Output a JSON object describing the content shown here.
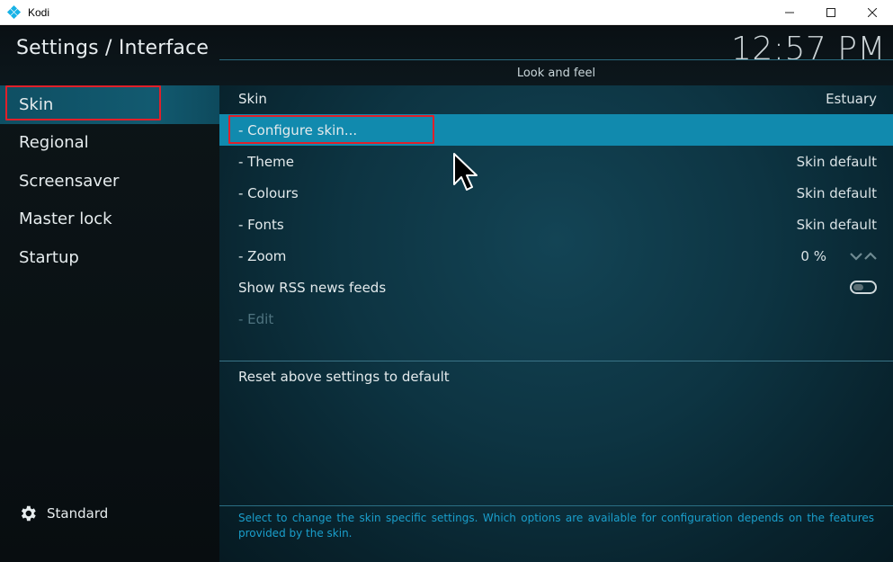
{
  "window": {
    "title": "Kodi"
  },
  "header": {
    "title": "Settings / Interface",
    "clock": "12:57 PM"
  },
  "sidebar": {
    "items": [
      {
        "label": "Skin",
        "active": true
      },
      {
        "label": "Regional",
        "active": false
      },
      {
        "label": "Screensaver",
        "active": false
      },
      {
        "label": "Master lock",
        "active": false
      },
      {
        "label": "Startup",
        "active": false
      }
    ],
    "footer_label": "Standard"
  },
  "main": {
    "group_title": "Look and feel",
    "settings": [
      {
        "label": "Skin",
        "value": "Estuary"
      },
      {
        "label": "- Configure skin...",
        "value": ""
      },
      {
        "label": "- Theme",
        "value": "Skin default"
      },
      {
        "label": "- Colours",
        "value": "Skin default"
      },
      {
        "label": "- Fonts",
        "value": "Skin default"
      },
      {
        "label": "- Zoom",
        "value": "0 %"
      },
      {
        "label": "Show RSS news feeds",
        "value": ""
      },
      {
        "label": "- Edit",
        "value": ""
      }
    ],
    "reset_label": "Reset above settings to default",
    "help_text": "Select to change the skin specific settings. Which options are available for configuration depends on the features provided by the skin."
  },
  "colors": {
    "focus": "#118aae",
    "highlight_box": "#e0202a",
    "help_text": "#1a9fcc"
  }
}
